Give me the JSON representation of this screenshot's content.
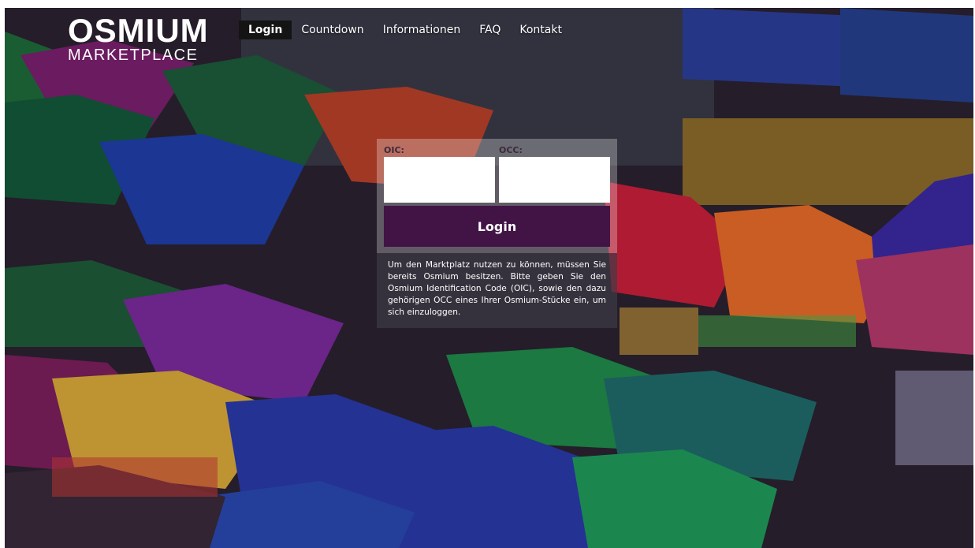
{
  "logo": {
    "line1": "OSMIUM",
    "line2": "MARKETPLACE"
  },
  "nav": {
    "items": [
      {
        "label": "Login",
        "active": true
      },
      {
        "label": "Countdown",
        "active": false
      },
      {
        "label": "Informationen",
        "active": false
      },
      {
        "label": "FAQ",
        "active": false
      },
      {
        "label": "Kontakt",
        "active": false
      }
    ]
  },
  "login": {
    "oic_label": "OIC:",
    "occ_label": "OCC:",
    "oic_value": "",
    "occ_value": "",
    "button_label": "Login"
  },
  "info": {
    "text": "Um den Marktplatz nutzen zu können, müssen Sie bereits Osmium besitzen. Bitte geben Sie den Osmium Identification Code (OIC), sowie den dazu gehörigen OCC eines Ihrer Osmium-Stücke ein, um sich einzuloggen."
  },
  "colors": {
    "button": "#421446",
    "nav_active": "#141414"
  }
}
